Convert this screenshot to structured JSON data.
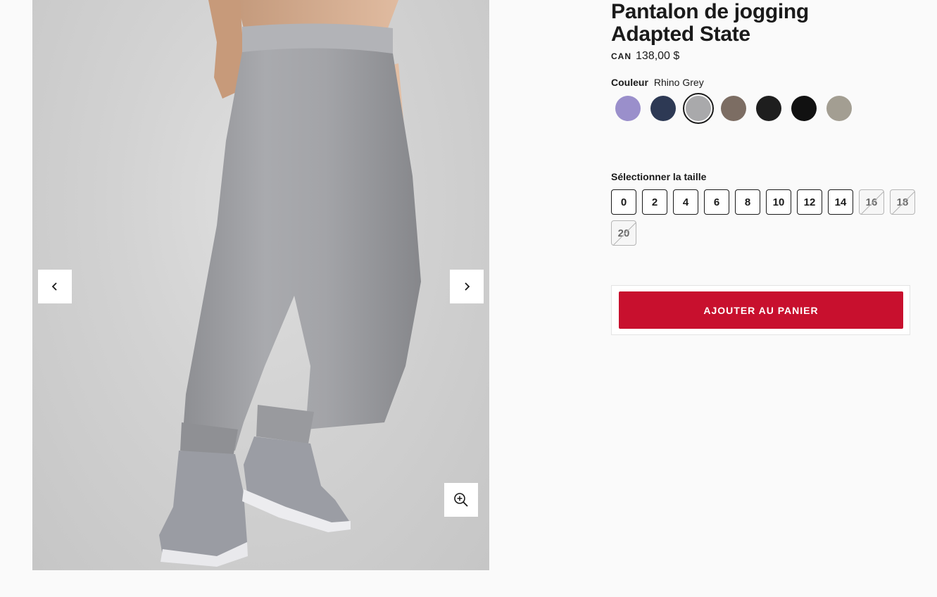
{
  "product": {
    "title_line1": "Pantalon de jogging",
    "title_line2": "Adapted State",
    "currency": "CAN",
    "price": "138,00 $"
  },
  "color": {
    "label": "Couleur",
    "selected_name": "Rhino Grey",
    "swatches": [
      {
        "name": "lavender",
        "hex": "#9a8fcb"
      },
      {
        "name": "navy",
        "hex": "#2d3954"
      },
      {
        "name": "rhino-grey",
        "hex": "#a9a9ab",
        "selected": true
      },
      {
        "name": "taupe",
        "hex": "#7c6d63"
      },
      {
        "name": "black",
        "hex": "#1e1e1e"
      },
      {
        "name": "black-2",
        "hex": "#111111"
      },
      {
        "name": "heathered-khaki",
        "hex": "#a39e92"
      }
    ]
  },
  "size": {
    "label": "Sélectionner la taille",
    "options": [
      {
        "value": "0",
        "available": true
      },
      {
        "value": "2",
        "available": true
      },
      {
        "value": "4",
        "available": true
      },
      {
        "value": "6",
        "available": true
      },
      {
        "value": "8",
        "available": true
      },
      {
        "value": "10",
        "available": true
      },
      {
        "value": "12",
        "available": true
      },
      {
        "value": "14",
        "available": true
      },
      {
        "value": "16",
        "available": false
      },
      {
        "value": "18",
        "available": false
      },
      {
        "value": "20",
        "available": false
      }
    ]
  },
  "cart": {
    "button_label": "AJOUTER AU PANIER",
    "accent": "#c8102e"
  },
  "gallery": {
    "prev_icon": "chevron-left-icon",
    "next_icon": "chevron-right-icon",
    "zoom_icon": "zoom-in-icon"
  }
}
